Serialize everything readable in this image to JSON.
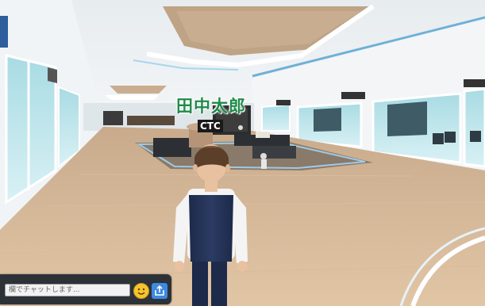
{
  "avatar": {
    "name": "田中太郎",
    "organization": "CTC"
  },
  "chat": {
    "placeholder": "欄でチャットします..."
  },
  "icons": {
    "emoji": "smiley-icon",
    "send": "share-upload-icon"
  }
}
